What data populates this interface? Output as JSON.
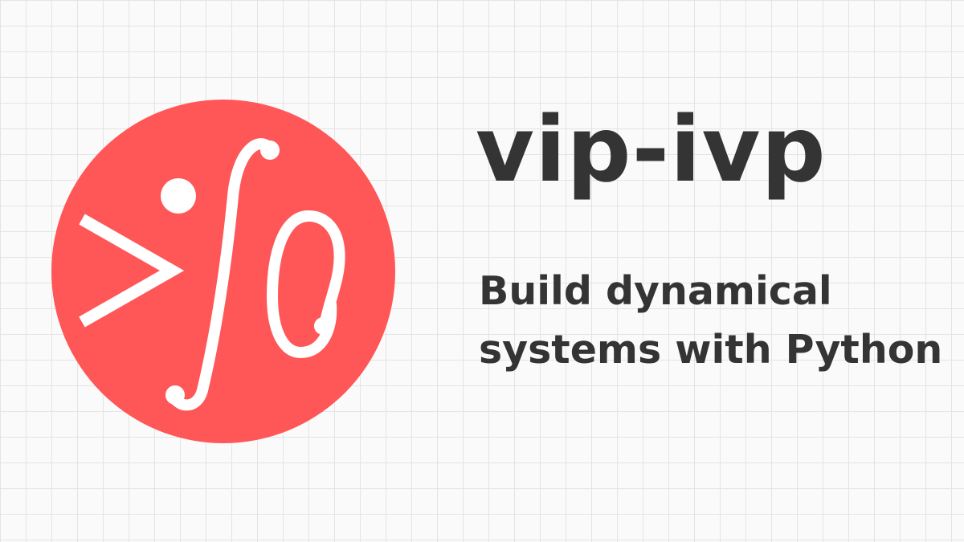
{
  "brand": {
    "title": "vip-ivp",
    "tagline": "Build dynamical systems with Python",
    "logo_icon": "integral-symbol-logo-icon",
    "colors": {
      "logo_circle": "#ff5757",
      "logo_glyph": "#ffffff",
      "text": "#343434",
      "background": "#fafafa",
      "grid_line": "#e4e4e4"
    }
  }
}
